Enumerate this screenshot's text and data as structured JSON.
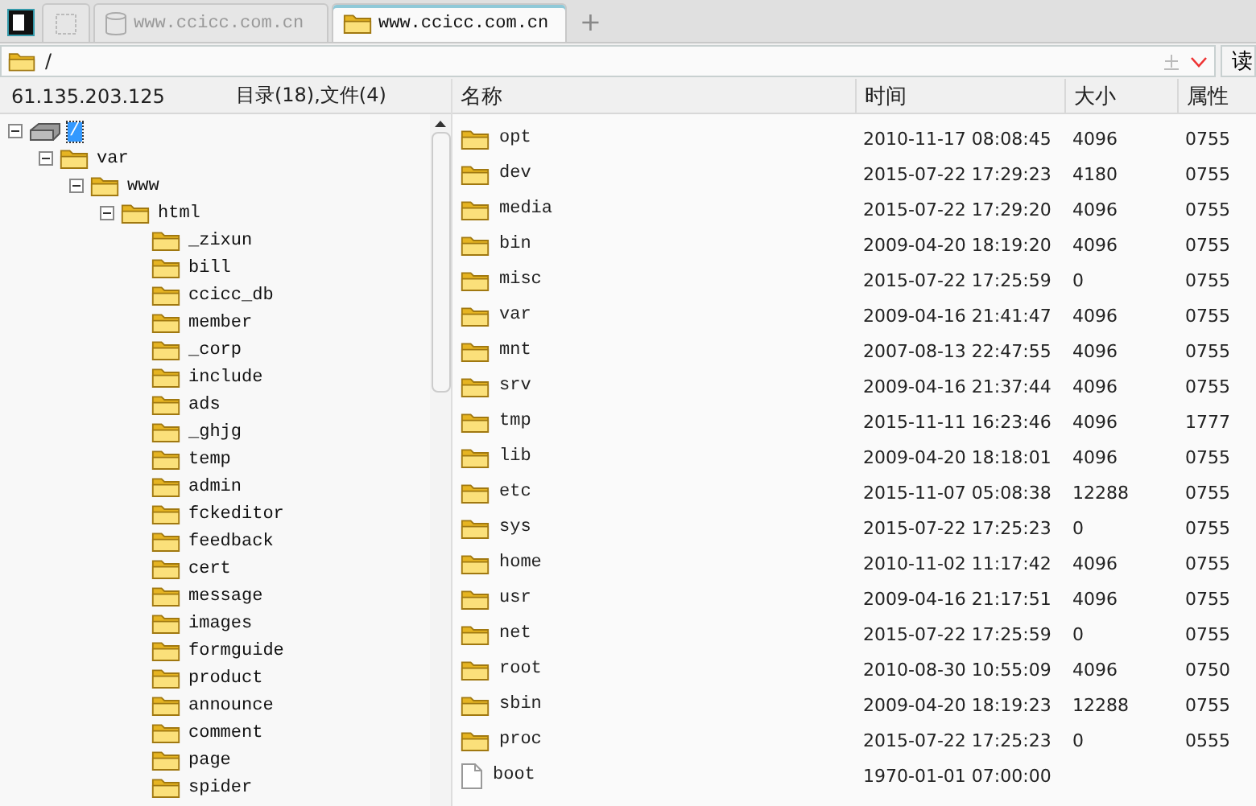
{
  "tabs": [
    {
      "kind": "panel-toggle",
      "selected": false
    },
    {
      "kind": "empty",
      "selected": false
    },
    {
      "kind": "database",
      "label": "www.ccicc.com.cn",
      "selected": false
    },
    {
      "kind": "folder",
      "label": "www.ccicc.com.cn",
      "selected": true
    }
  ],
  "new_tab": "+",
  "address": {
    "value": "/",
    "button": "读"
  },
  "left_header": {
    "host": "61.135.203.125",
    "summary": "目录(18),文件(4)"
  },
  "tree": [
    {
      "kind": "drive",
      "label": "/",
      "expanded": true,
      "selected": true,
      "children": [
        {
          "kind": "folder",
          "label": "var",
          "expanded": true,
          "selected": false,
          "children": [
            {
              "kind": "folder",
              "label": "www",
              "expanded": true,
              "selected": false,
              "children": [
                {
                  "kind": "folder",
                  "label": "html",
                  "expanded": true,
                  "selected": false,
                  "children": [
                    {
                      "kind": "folder",
                      "label": "_zixun",
                      "selected": false
                    },
                    {
                      "kind": "folder",
                      "label": "bill",
                      "selected": false
                    },
                    {
                      "kind": "folder",
                      "label": "ccicc_db",
                      "selected": false
                    },
                    {
                      "kind": "folder",
                      "label": "member",
                      "selected": false
                    },
                    {
                      "kind": "folder",
                      "label": "_corp",
                      "selected": false
                    },
                    {
                      "kind": "folder",
                      "label": "include",
                      "selected": false
                    },
                    {
                      "kind": "folder",
                      "label": "ads",
                      "selected": false
                    },
                    {
                      "kind": "folder",
                      "label": "_ghjg",
                      "selected": false
                    },
                    {
                      "kind": "folder",
                      "label": "temp",
                      "selected": false
                    },
                    {
                      "kind": "folder",
                      "label": "admin",
                      "selected": false
                    },
                    {
                      "kind": "folder",
                      "label": "fckeditor",
                      "selected": false
                    },
                    {
                      "kind": "folder",
                      "label": "feedback",
                      "selected": false
                    },
                    {
                      "kind": "folder",
                      "label": "cert",
                      "selected": false
                    },
                    {
                      "kind": "folder",
                      "label": "message",
                      "selected": false
                    },
                    {
                      "kind": "folder",
                      "label": "images",
                      "selected": false
                    },
                    {
                      "kind": "folder",
                      "label": "formguide",
                      "selected": false
                    },
                    {
                      "kind": "folder",
                      "label": "product",
                      "selected": false
                    },
                    {
                      "kind": "folder",
                      "label": "announce",
                      "selected": false
                    },
                    {
                      "kind": "folder",
                      "label": "comment",
                      "selected": false
                    },
                    {
                      "kind": "folder",
                      "label": "page",
                      "selected": false
                    },
                    {
                      "kind": "folder",
                      "label": "spider",
                      "selected": false
                    }
                  ]
                }
              ]
            }
          ]
        }
      ]
    }
  ],
  "table": {
    "columns": [
      "名称",
      "时间",
      "大小",
      "属性"
    ],
    "rows": [
      {
        "kind": "folder",
        "name": "opt",
        "time": "2010-11-17 08:08:45",
        "size": "4096",
        "attr": "0755"
      },
      {
        "kind": "folder",
        "name": "dev",
        "time": "2015-07-22 17:29:23",
        "size": "4180",
        "attr": "0755"
      },
      {
        "kind": "folder",
        "name": "media",
        "time": "2015-07-22 17:29:20",
        "size": "4096",
        "attr": "0755"
      },
      {
        "kind": "folder",
        "name": "bin",
        "time": "2009-04-20 18:19:20",
        "size": "4096",
        "attr": "0755"
      },
      {
        "kind": "folder",
        "name": "misc",
        "time": "2015-07-22 17:25:59",
        "size": "0",
        "attr": "0755"
      },
      {
        "kind": "folder",
        "name": "var",
        "time": "2009-04-16 21:41:47",
        "size": "4096",
        "attr": "0755"
      },
      {
        "kind": "folder",
        "name": "mnt",
        "time": "2007-08-13 22:47:55",
        "size": "4096",
        "attr": "0755"
      },
      {
        "kind": "folder",
        "name": "srv",
        "time": "2009-04-16 21:37:44",
        "size": "4096",
        "attr": "0755"
      },
      {
        "kind": "folder",
        "name": "tmp",
        "time": "2015-11-11 16:23:46",
        "size": "4096",
        "attr": "1777"
      },
      {
        "kind": "folder",
        "name": "lib",
        "time": "2009-04-20 18:18:01",
        "size": "4096",
        "attr": "0755"
      },
      {
        "kind": "folder",
        "name": "etc",
        "time": "2015-11-07 05:08:38",
        "size": "12288",
        "attr": "0755"
      },
      {
        "kind": "folder",
        "name": "sys",
        "time": "2015-07-22 17:25:23",
        "size": "0",
        "attr": "0755"
      },
      {
        "kind": "folder",
        "name": "home",
        "time": "2010-11-02 11:17:42",
        "size": "4096",
        "attr": "0755"
      },
      {
        "kind": "folder",
        "name": "usr",
        "time": "2009-04-16 21:17:51",
        "size": "4096",
        "attr": "0755"
      },
      {
        "kind": "folder",
        "name": "net",
        "time": "2015-07-22 17:25:59",
        "size": "0",
        "attr": "0755"
      },
      {
        "kind": "folder",
        "name": "root",
        "time": "2010-08-30 10:55:09",
        "size": "4096",
        "attr": "0750"
      },
      {
        "kind": "folder",
        "name": "sbin",
        "time": "2009-04-20 18:19:23",
        "size": "12288",
        "attr": "0755"
      },
      {
        "kind": "folder",
        "name": "proc",
        "time": "2015-07-22 17:25:23",
        "size": "0",
        "attr": "0555"
      },
      {
        "kind": "file",
        "name": "boot",
        "time": "1970-01-01 07:00:00"
      }
    ]
  }
}
